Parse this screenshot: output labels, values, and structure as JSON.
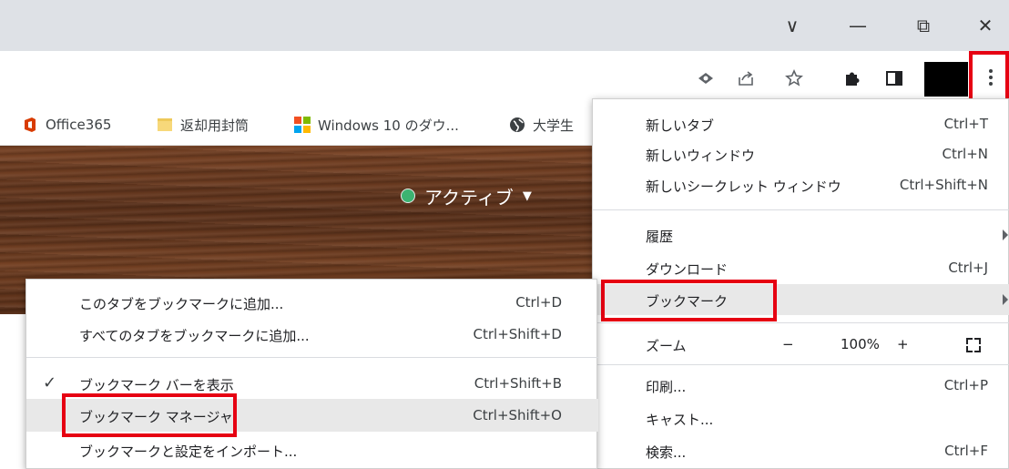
{
  "window_controls": {
    "tab_list": "∨",
    "minimize": "—",
    "restore": "⧉",
    "close": "✕"
  },
  "toolbar": {
    "icons": [
      "eye-icon",
      "share-icon",
      "star-icon",
      "puzzle-icon",
      "sidepanel-icon",
      "kebab-icon"
    ]
  },
  "bookmarks_bar": [
    {
      "label": "Office365",
      "icon": "office-icon"
    },
    {
      "label": "返却用封筒",
      "icon": "folder-icon"
    },
    {
      "label": "Windows 10 のダウ...",
      "icon": "windows-icon"
    },
    {
      "label": "大学生",
      "icon": "globe-icon"
    }
  ],
  "page": {
    "status_label": "アクティブ",
    "status_caret": "▼"
  },
  "chrome_menu": {
    "new_tab": {
      "label": "新しいタブ",
      "shortcut": "Ctrl+T"
    },
    "new_window": {
      "label": "新しいウィンドウ",
      "shortcut": "Ctrl+N"
    },
    "new_incognito": {
      "label": "新しいシークレット ウィンドウ",
      "shortcut": "Ctrl+Shift+N"
    },
    "history": {
      "label": "履歴"
    },
    "downloads": {
      "label": "ダウンロード",
      "shortcut": "Ctrl+J"
    },
    "bookmarks": {
      "label": "ブックマーク"
    },
    "zoom": {
      "label": "ズーム",
      "minus": "−",
      "value": "100%",
      "plus": "+"
    },
    "print": {
      "label": "印刷...",
      "shortcut": "Ctrl+P"
    },
    "cast": {
      "label": "キャスト..."
    },
    "find": {
      "label": "検索...",
      "shortcut": "Ctrl+F"
    }
  },
  "bookmarks_submenu": {
    "add_tab": {
      "label": "このタブをブックマークに追加...",
      "shortcut": "Ctrl+D"
    },
    "add_all_tabs": {
      "label": "すべてのタブをブックマークに追加...",
      "shortcut": "Ctrl+Shift+D"
    },
    "show_bar": {
      "label": "ブックマーク バーを表示",
      "shortcut": "Ctrl+Shift+B",
      "checked": true
    },
    "manager": {
      "label": "ブックマーク マネージャ",
      "shortcut": "Ctrl+Shift+O"
    },
    "import": {
      "label": "ブックマークと設定をインポート..."
    }
  },
  "highlight_color": "#e60012"
}
